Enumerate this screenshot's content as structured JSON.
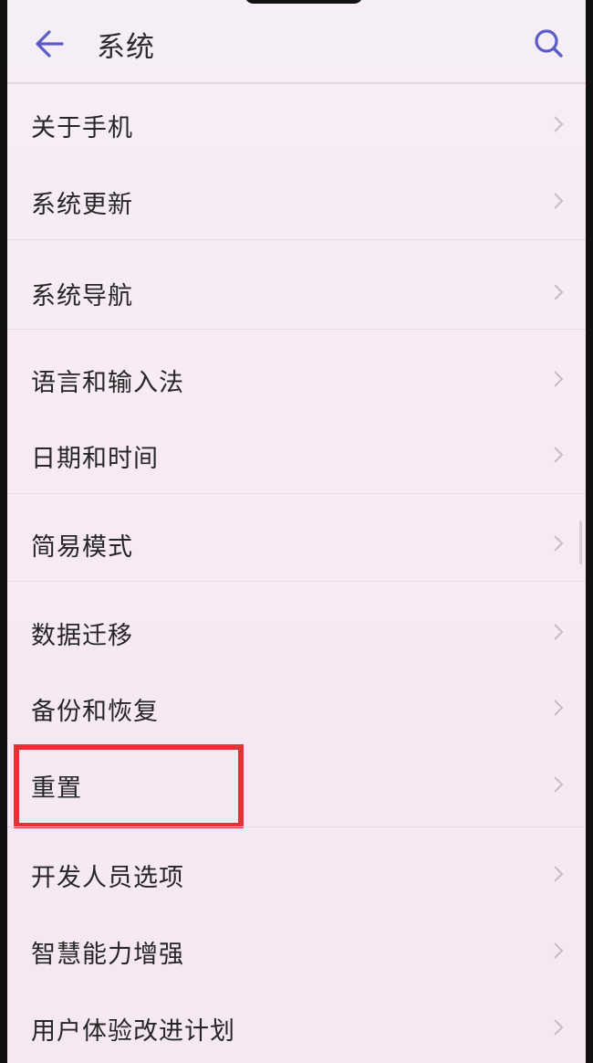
{
  "header": {
    "title": "系统",
    "back_icon": "arrow-left-icon",
    "search_icon": "search-icon"
  },
  "menu": {
    "items": [
      {
        "label": "关于手机"
      },
      {
        "label": "系统更新"
      },
      {
        "label": "系统导航"
      },
      {
        "label": "语言和输入法"
      },
      {
        "label": "日期和时间"
      },
      {
        "label": "简易模式"
      },
      {
        "label": "数据迁移"
      },
      {
        "label": "备份和恢复"
      },
      {
        "label": "重置"
      },
      {
        "label": "开发人员选项"
      },
      {
        "label": "智慧能力增强"
      },
      {
        "label": "用户体验改进计划"
      }
    ]
  },
  "colors": {
    "accent": "#5b5cc7",
    "highlight": "#e23434",
    "chevron": "#c9bcc7"
  }
}
